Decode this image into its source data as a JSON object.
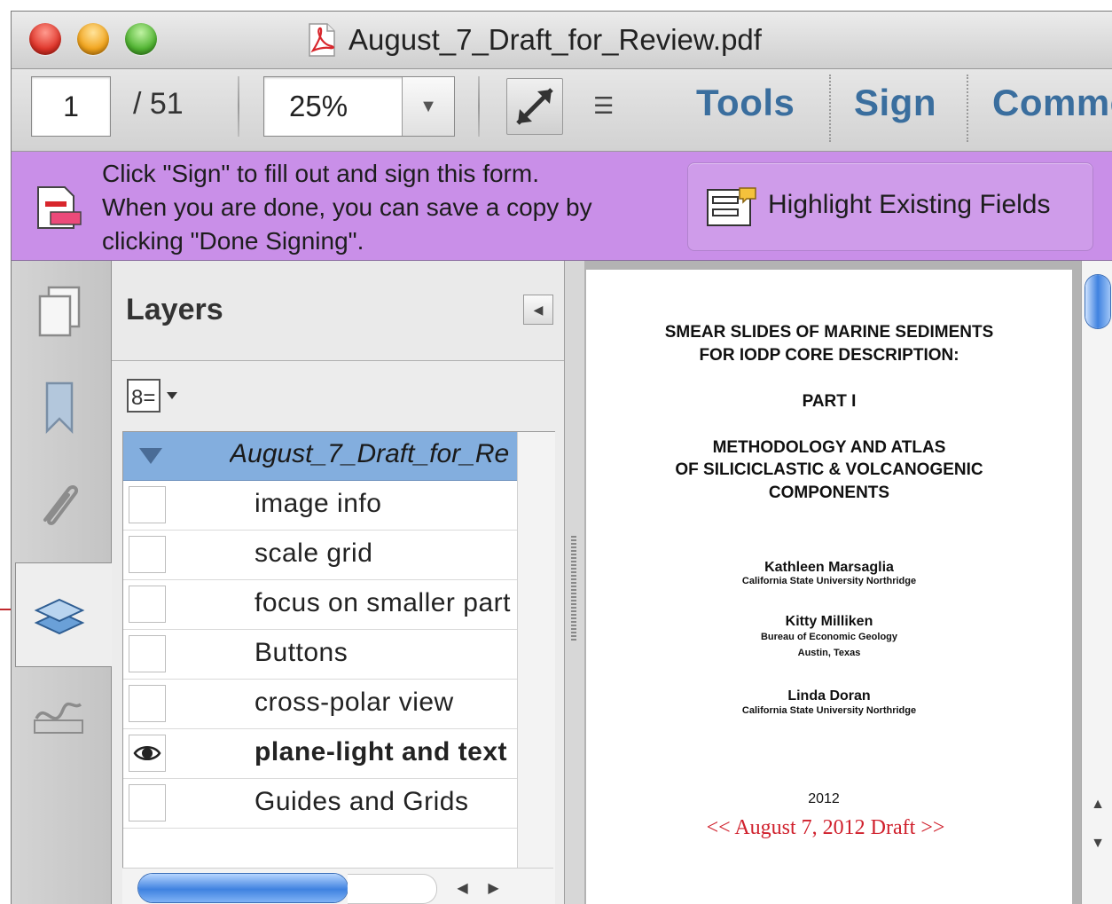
{
  "window": {
    "title": "August_7_Draft_for_Review.pdf",
    "title_icon": "pdf-document-icon"
  },
  "toolbar": {
    "page_current": "1",
    "page_total": "/ 51",
    "zoom": "25%",
    "tools_label": "Tools",
    "sign_label": "Sign",
    "comment_label": "Comme"
  },
  "signbar": {
    "message_line1": "Click \"Sign\" to fill out and sign this form.",
    "message_line2": "When you are done, you can save a copy by",
    "message_line3": "clicking \"Done Signing\".",
    "highlight_button": "Highlight Existing Fields",
    "background_color": "#c98fe8"
  },
  "layers_panel": {
    "title": "Layers",
    "root_layer": "August_7_Draft_for_Re",
    "items": [
      {
        "label": "image info",
        "visible": false
      },
      {
        "label": "scale grid",
        "visible": false
      },
      {
        "label": "focus on smaller part",
        "visible": false
      },
      {
        "label": "Buttons",
        "visible": false
      },
      {
        "label": "cross-polar view",
        "visible": false
      },
      {
        "label": "plane-light and text",
        "visible": true
      },
      {
        "label": "Guides and Grids",
        "visible": false
      }
    ]
  },
  "document": {
    "title_line1": "SMEAR SLIDES OF MARINE SEDIMENTS",
    "title_line2": "FOR IODP CORE DESCRIPTION:",
    "part": "PART I",
    "subtitle_line1": "METHODOLOGY AND ATLAS",
    "subtitle_line2": "OF SILICICLASTIC & VOLCANOGENIC",
    "subtitle_line3": "COMPONENTS",
    "author1": "Kathleen Marsaglia",
    "author1_affiliation": "California State University Northridge",
    "author2": "Kitty Milliken",
    "author2_affiliation": "Bureau of Economic Geology",
    "author2_location": "Austin, Texas",
    "author3": "Linda Doran",
    "author3_affiliation": "California State University Northridge",
    "year": "2012",
    "draft_note": "<< August 7, 2012 Draft >>",
    "draft_color": "#d0202c"
  },
  "accent_color": "#3a6e9e"
}
